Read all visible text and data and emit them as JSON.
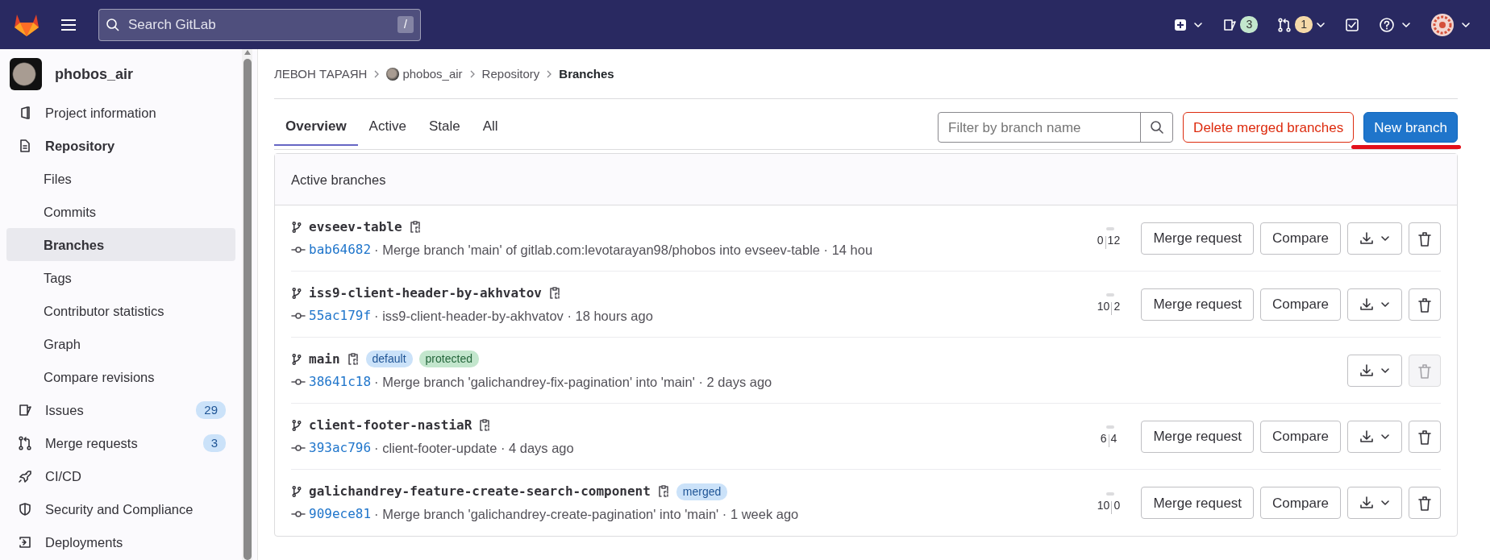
{
  "topbar": {
    "search": {
      "placeholder": "Search GitLab",
      "shortcut": "/"
    },
    "counters": [
      {
        "count": "3",
        "color": "#c3e6cd"
      },
      {
        "count": "1",
        "color": "#f5d9a8"
      }
    ]
  },
  "sidebar": {
    "project": "phobos_air",
    "items": [
      {
        "label": "Project information",
        "selected": false,
        "expanded": false
      },
      {
        "label": "Repository",
        "selected": false,
        "expanded": true,
        "children": [
          {
            "label": "Files",
            "selected": false
          },
          {
            "label": "Commits",
            "selected": false
          },
          {
            "label": "Branches",
            "selected": true
          },
          {
            "label": "Tags",
            "selected": false
          },
          {
            "label": "Contributor statistics",
            "selected": false
          },
          {
            "label": "Graph",
            "selected": false
          },
          {
            "label": "Compare revisions",
            "selected": false
          }
        ]
      },
      {
        "label": "Issues",
        "count": "29",
        "selected": false,
        "expanded": false
      },
      {
        "label": "Merge requests",
        "count": "3",
        "selected": false,
        "expanded": false
      },
      {
        "label": "CI/CD",
        "selected": false,
        "expanded": false
      },
      {
        "label": "Security and Compliance",
        "selected": false,
        "expanded": false
      },
      {
        "label": "Deployments",
        "selected": false,
        "expanded": false
      }
    ]
  },
  "breadcrumbs": [
    "ЛЕВОН ТАРАЯН",
    "phobos_air",
    "Repository",
    "Branches"
  ],
  "tabs": [
    {
      "label": "Overview",
      "selected": true
    },
    {
      "label": "Active",
      "selected": false
    },
    {
      "label": "Stale",
      "selected": false
    },
    {
      "label": "All",
      "selected": false
    }
  ],
  "filter": {
    "placeholder": "Filter by branch name"
  },
  "actions": {
    "delete_merged": "Delete merged branches",
    "new_branch": "New branch"
  },
  "card": {
    "title": "Active branches",
    "branches": [
      {
        "name": "evseev-table",
        "sha": "bab64682",
        "commit": "· Merge branch 'main' of gitlab.com:levotarayan98/phobos into evseev-table · 14 hou",
        "behind": "0",
        "ahead": "12",
        "buttons": [
          "Merge request",
          "Compare"
        ],
        "delete_disabled": false
      },
      {
        "name": "iss9-client-header-by-akhvatov",
        "sha": "55ac179f",
        "commit": "· iss9-client-header-by-akhvatov · 18 hours ago",
        "behind": "10",
        "ahead": "2",
        "buttons": [
          "Merge request",
          "Compare"
        ],
        "delete_disabled": false
      },
      {
        "name": "main",
        "tags": [
          {
            "label": "default",
            "kind": "info"
          },
          {
            "label": "protected",
            "kind": "success"
          }
        ],
        "sha": "38641c18",
        "commit": "· Merge branch 'galichandrey-fix-pagination' into 'main' · 2 days ago",
        "delete_disabled": true
      },
      {
        "name": "client-footer-nastiaR",
        "sha": "393ac796",
        "commit": "· client-footer-update · 4 days ago",
        "behind": "6",
        "ahead": "4",
        "buttons": [
          "Merge request",
          "Compare"
        ],
        "delete_disabled": false
      },
      {
        "name": "galichandrey-feature-create-search-component",
        "tags": [
          {
            "label": "merged",
            "kind": "info"
          }
        ],
        "sha": "909ece81",
        "commit": "· Merge branch 'galichandrey-create-pagination' into 'main' · 1 week ago",
        "behind": "10",
        "ahead": "0",
        "buttons": [
          "Merge request",
          "Compare"
        ],
        "delete_disabled": false
      }
    ]
  }
}
